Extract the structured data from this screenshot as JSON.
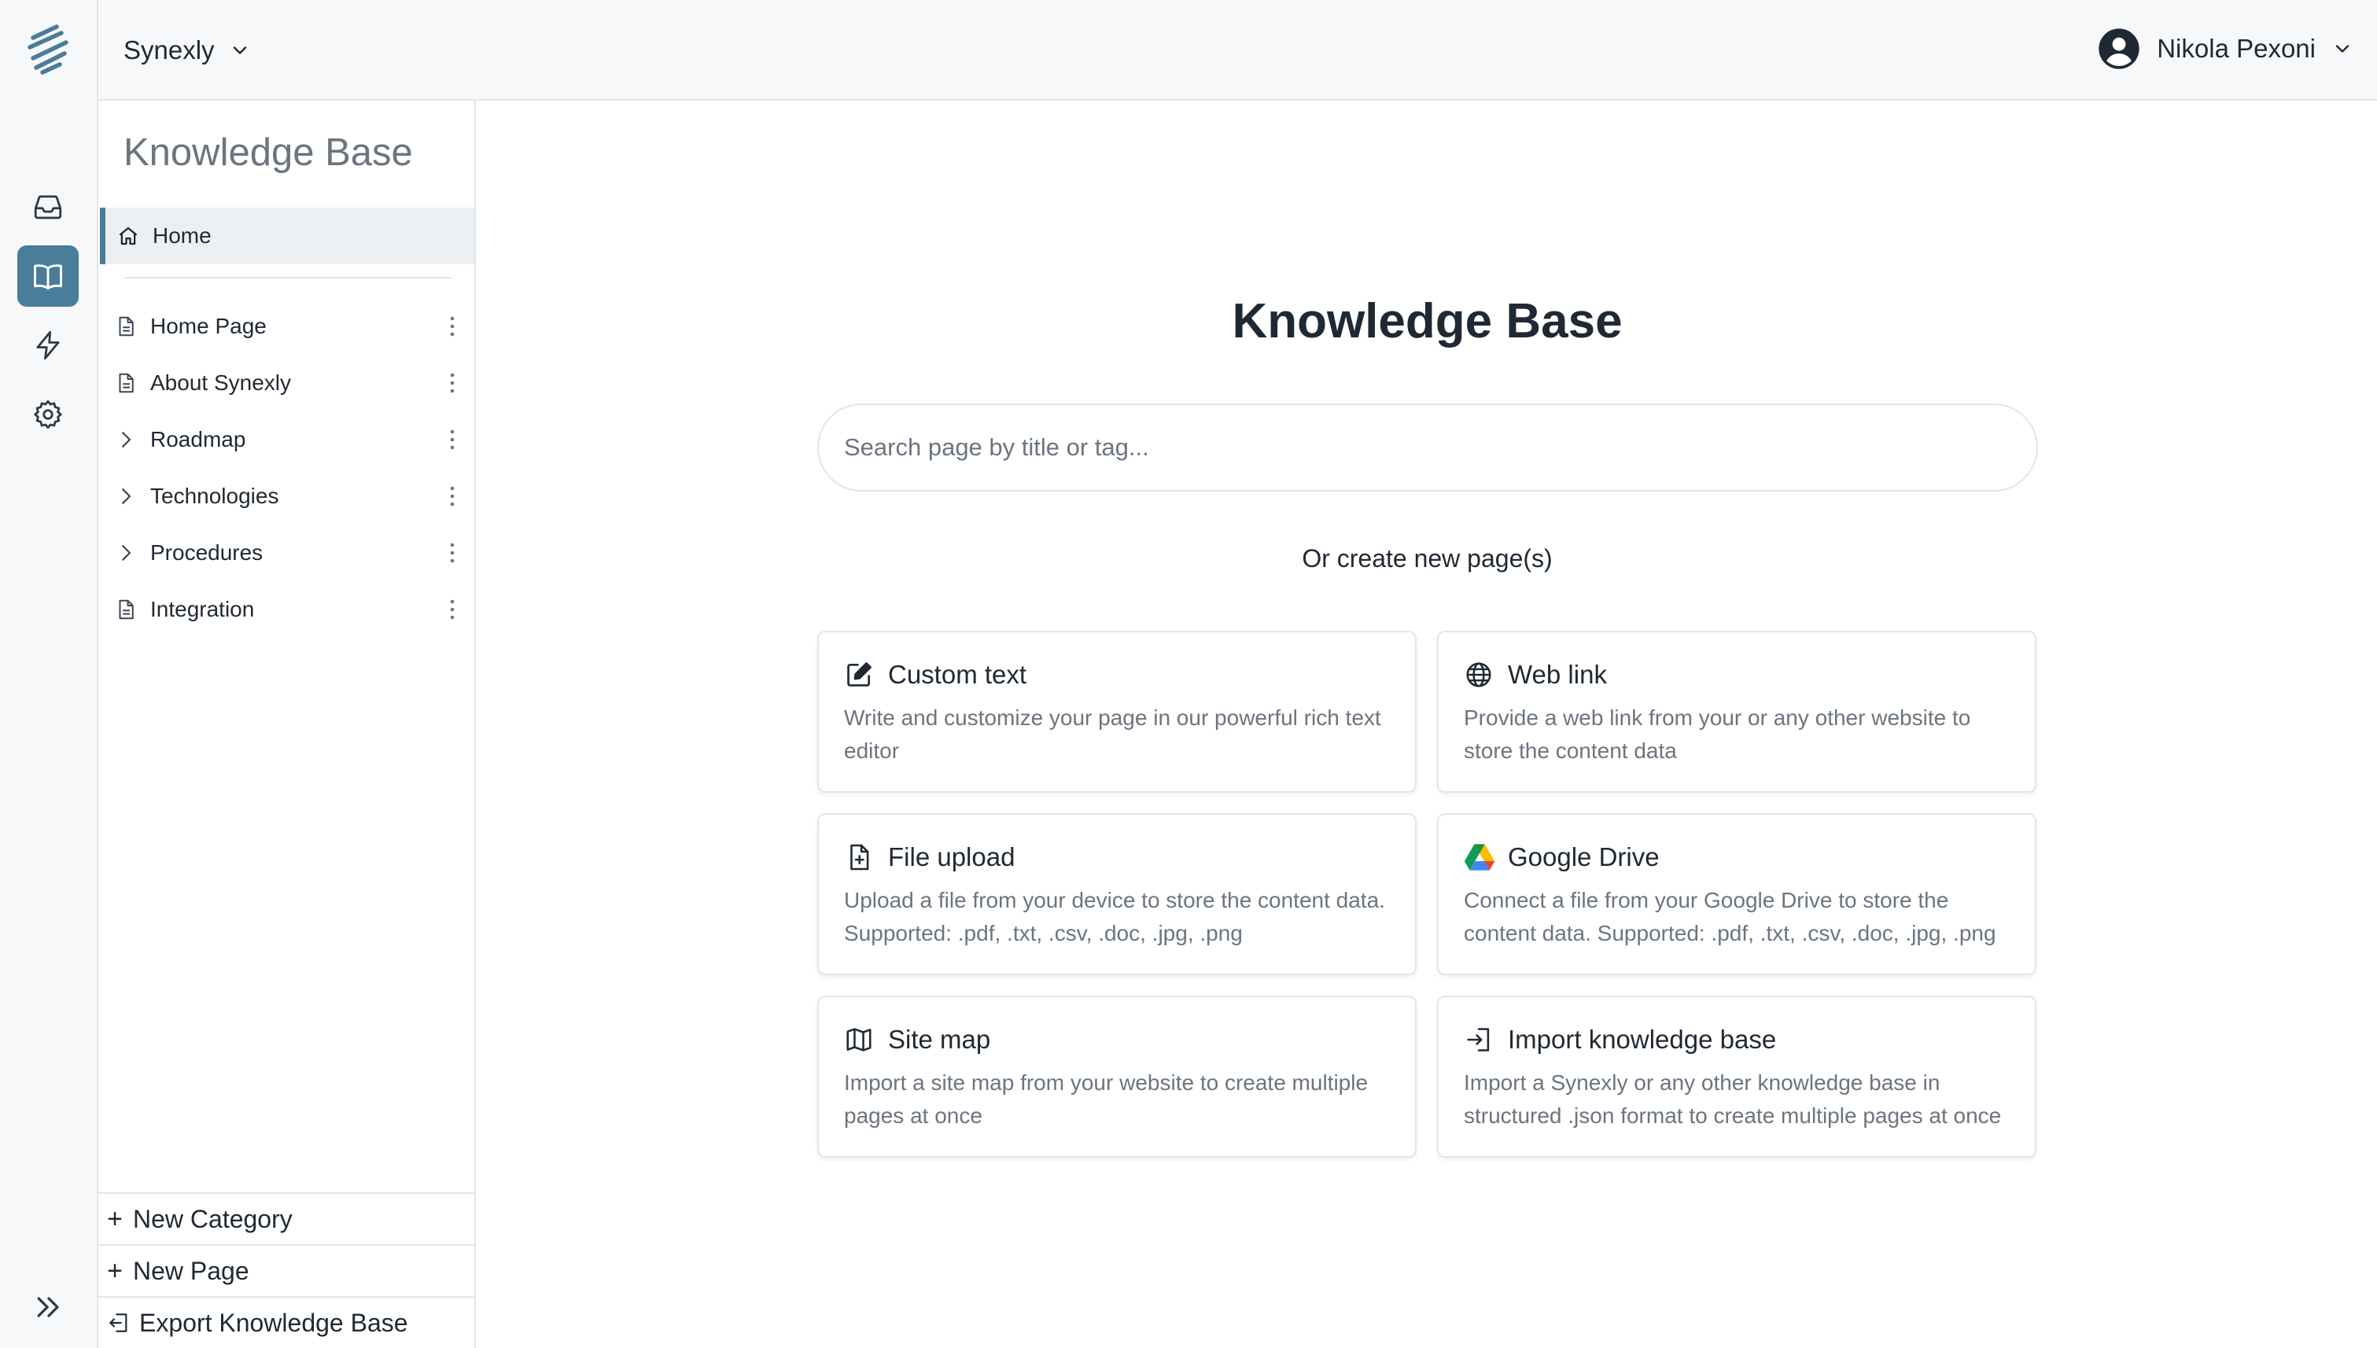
{
  "workspace": {
    "name": "Synexly"
  },
  "user": {
    "name": "Nikola Pexoni"
  },
  "rail": {
    "items": [
      {
        "icon": "inbox-icon"
      },
      {
        "icon": "book-open-icon",
        "active": true
      },
      {
        "icon": "lightning-icon"
      },
      {
        "icon": "gear-icon"
      }
    ],
    "expand_icon": "chevrons-right-icon"
  },
  "sidebar": {
    "title": "Knowledge Base",
    "home_label": "Home",
    "items": [
      {
        "label": "Home Page",
        "type": "page"
      },
      {
        "label": "About Synexly",
        "type": "page"
      },
      {
        "label": "Roadmap",
        "type": "folder"
      },
      {
        "label": "Technologies",
        "type": "folder"
      },
      {
        "label": "Procedures",
        "type": "folder"
      },
      {
        "label": "Integration",
        "type": "page"
      }
    ],
    "footer": {
      "new_category": "New Category",
      "new_page": "New Page",
      "export": "Export Knowledge Base"
    }
  },
  "main": {
    "title": "Knowledge Base",
    "search_placeholder": "Search page by title or tag...",
    "or_create": "Or create new page(s)",
    "cards": [
      {
        "title": "Custom text",
        "desc": "Write and customize your page in our powerful rich text editor",
        "icon": "edit-icon"
      },
      {
        "title": "Web link",
        "desc": "Provide a web link from your or any other website to store the content data",
        "icon": "globe-icon"
      },
      {
        "title": "File upload",
        "desc": "Upload a file from your device to store the content data. Supported: .pdf, .txt, .csv, .doc, .jpg, .png",
        "icon": "file-plus-icon"
      },
      {
        "title": "Google Drive",
        "desc": "Connect a file from your Google Drive to store the content data. Supported: .pdf, .txt, .csv, .doc, .jpg, .png",
        "icon": "google-drive-icon"
      },
      {
        "title": "Site map",
        "desc": "Import a site map from your website to create multiple pages at once",
        "icon": "map-icon"
      },
      {
        "title": "Import knowledge base",
        "desc": "Import a Synexly or any other knowledge base in structured .json format to create multiple pages at once",
        "icon": "sign-in-icon"
      }
    ]
  },
  "colors": {
    "accent": "#4a7c9b",
    "text": "#1f2933",
    "muted": "#6b7580",
    "border": "#e3e6e9",
    "chrome_bg": "#f7f8f9"
  }
}
